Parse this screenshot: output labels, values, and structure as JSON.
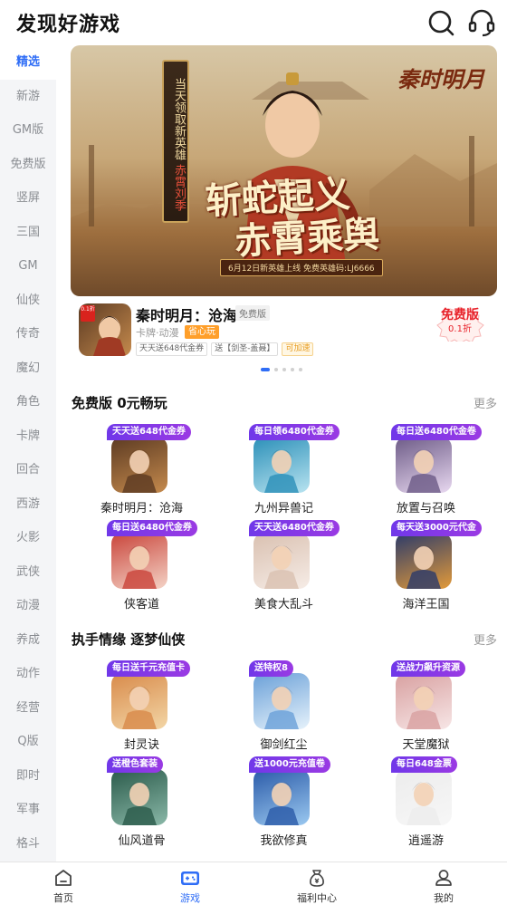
{
  "header": {
    "title": "发现好游戏",
    "search_icon": "search-icon",
    "service_icon": "headset-icon"
  },
  "sidebar": {
    "items": [
      "精选",
      "新游",
      "GM版",
      "免费版",
      "竖屏",
      "三国",
      "GM",
      "仙侠",
      "传奇",
      "魔幻",
      "角色",
      "卡牌",
      "回合",
      "西游",
      "火影",
      "武侠",
      "动漫",
      "养成",
      "动作",
      "经营",
      "Q版",
      "即时",
      "军事",
      "格斗"
    ],
    "active_index": 0
  },
  "banner": {
    "scroll_text_top": "当天领取新英雄",
    "scroll_text_red": "赤霄刘季",
    "slogan_line1": "斩蛇起义",
    "slogan_line2": "赤霄乘舆",
    "promo": "6月12日新英雄上线 免费英雄码:LJ6666",
    "brand": "秦时明月"
  },
  "featured": {
    "icon_tag": "0.1折",
    "name": "秦时明月：沧海",
    "badge": "免费版",
    "genre": "卡牌·动漫",
    "hot_tag": "省心玩",
    "tags": [
      "天天送648代金券",
      "送【剑圣-盖聂】",
      "可加速"
    ],
    "free_label": "免费版",
    "discount": "0.1折"
  },
  "carousel": {
    "dots": 5,
    "active": 0
  },
  "sections": [
    {
      "title": "免费版 0元畅玩",
      "more": "更多",
      "games": [
        {
          "name": "秦时明月：沧海",
          "ribbon": "天天送648代金券"
        },
        {
          "name": "九州异兽记",
          "ribbon": "每日领6480代金券"
        },
        {
          "name": "放置与召唤",
          "ribbon": "每日送6480代金卷"
        },
        {
          "name": "侠客道",
          "ribbon": "每日送6480代金券"
        },
        {
          "name": "美食大乱斗",
          "ribbon": "天天送6480代金券"
        },
        {
          "name": "海洋王国",
          "ribbon": "每天送3000元代金"
        }
      ]
    },
    {
      "title": "执手情缘 逐梦仙侠",
      "more": "更多",
      "games": [
        {
          "name": "封灵诀",
          "ribbon": "每日送千元充值卡"
        },
        {
          "name": "御剑红尘",
          "ribbon": "送特权8"
        },
        {
          "name": "天堂魔狱",
          "ribbon": "送战力飙升资源"
        },
        {
          "name": "仙风道骨",
          "ribbon": "送橙色套装"
        },
        {
          "name": "我欲修真",
          "ribbon": "送1000元充值卷"
        },
        {
          "name": "逍遥游",
          "ribbon": "每日648金票"
        }
      ]
    }
  ],
  "tabbar": {
    "items": [
      {
        "label": "首页",
        "icon": "home-icon"
      },
      {
        "label": "游戏",
        "icon": "gamepad-icon"
      },
      {
        "label": "福利中心",
        "icon": "gift-bag-icon"
      },
      {
        "label": "我的",
        "icon": "user-icon"
      }
    ],
    "active_index": 1
  },
  "colors": {
    "accent": "#2f6df6",
    "ribbon": "#7a38e8",
    "free_red": "#e8232b"
  }
}
